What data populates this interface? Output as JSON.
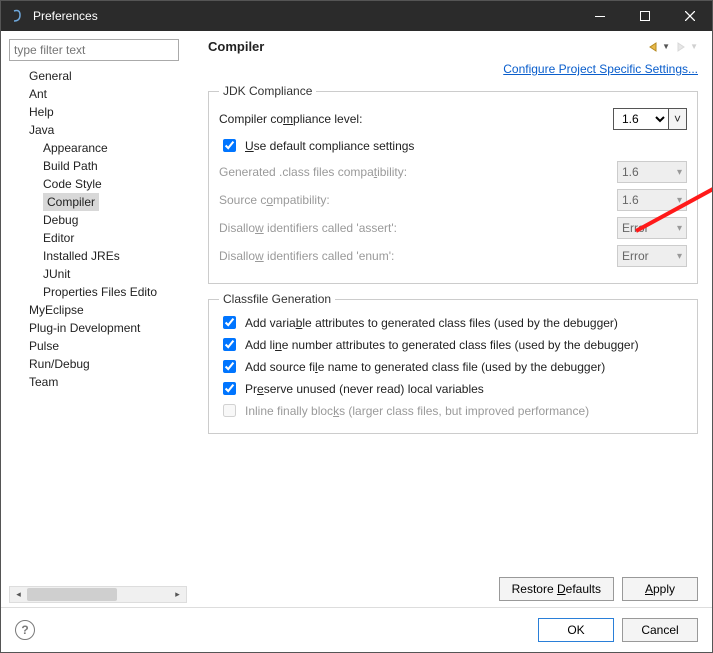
{
  "window": {
    "title": "Preferences",
    "minimize": "—",
    "maximize": "▢",
    "close": "✕"
  },
  "filter": {
    "placeholder": "type filter text"
  },
  "tree": {
    "general": "General",
    "ant": "Ant",
    "help": "Help",
    "java": "Java",
    "java_children": {
      "appearance": "Appearance",
      "buildpath": "Build Path",
      "codestyle": "Code Style",
      "compiler": "Compiler",
      "debug": "Debug",
      "editor": "Editor",
      "installedjres": "Installed JREs",
      "junit": "JUnit",
      "propfiles": "Properties Files Edito"
    },
    "myeclipse": "MyEclipse",
    "plugindev": "Plug-in Development",
    "pulse": "Pulse",
    "rundebug": "Run/Debug",
    "team": "Team"
  },
  "page": {
    "heading": "Compiler",
    "configure_link": "Configure Project Specific Settings...",
    "jdk": {
      "legend": "JDK Compliance",
      "level_label": "Compiler compliance level:",
      "level_value": "1.6",
      "use_default": "Use default compliance settings",
      "gen_class": "Generated .class files compatibility:",
      "gen_class_val": "1.6",
      "source": "Source compatibility:",
      "source_val": "1.6",
      "assert": "Disallow identifiers called 'assert':",
      "assert_val": "Error",
      "enum": "Disallow identifiers called 'enum':",
      "enum_val": "Error"
    },
    "classfile": {
      "legend": "Classfile Generation",
      "c1": "Add variable attributes to generated class files (used by the debugger)",
      "c2": "Add line number attributes to generated class files (used by the debugger)",
      "c3": "Add source file name to generated class file (used by the debugger)",
      "c4": "Preserve unused (never read) local variables",
      "c5": "Inline finally blocks (larger class files, but improved performance)"
    },
    "restore": "Restore Defaults",
    "apply": "Apply"
  },
  "footer": {
    "ok": "OK",
    "cancel": "Cancel"
  }
}
